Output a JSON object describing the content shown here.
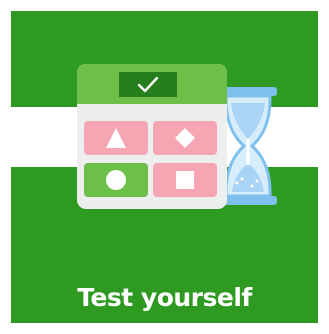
{
  "tile": {
    "caption": "Test yourself",
    "background_color": "#2f9a22",
    "band_color": "#ffffff"
  },
  "illustration": {
    "header_icon": "checkmark-icon",
    "header_color": "#6cc04a",
    "cell_shapes": [
      "triangle-icon",
      "diamond-icon",
      "circle-icon",
      "square-icon"
    ],
    "cell_colors": [
      "#f6a5b2",
      "#f6a5b2",
      "#6cc04a",
      "#f6a5b2"
    ],
    "timer_icon": "hourglass-icon",
    "timer_color": "#a9d4f5"
  }
}
